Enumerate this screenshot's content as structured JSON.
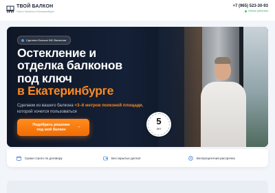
{
  "header": {
    "brand": "ТВОЙ БАЛКОН",
    "tagline": "Окна и балконы в Екатеринбурге",
    "phone": "+7 (965) 523-30-93",
    "status": "Сейчас работаем"
  },
  "hero": {
    "badge": "Сделали больше 540 балконов",
    "title_line1": "Остекление и",
    "title_line2": "отделка балконов",
    "title_line3": "под ключ",
    "title_accent": "в Екатеринбурге",
    "subtitle_pre": "Сделаем из вашего балкона ",
    "subtitle_hl": "+3–6 метров полезной площади",
    "subtitle_post": ", которой хочется пользоваться",
    "cta_line1": "Подобрать решение",
    "cta_line2": "под мой балкон",
    "cta_arrow": "→",
    "seal_number": "5",
    "seal_unit": "лет"
  },
  "features": [
    {
      "label": "Сроки строго по договору",
      "icon": "clock-icon"
    },
    {
      "label": "Без скрытых доплат",
      "icon": "wallet-icon"
    },
    {
      "label": "Беспроцентная рассрочка",
      "icon": "percent-icon"
    }
  ],
  "colors": {
    "accent": "#ff8a1e",
    "hero_bg": "#142036",
    "icon_blue": "#3a7bd5",
    "status_green": "#34c759"
  }
}
